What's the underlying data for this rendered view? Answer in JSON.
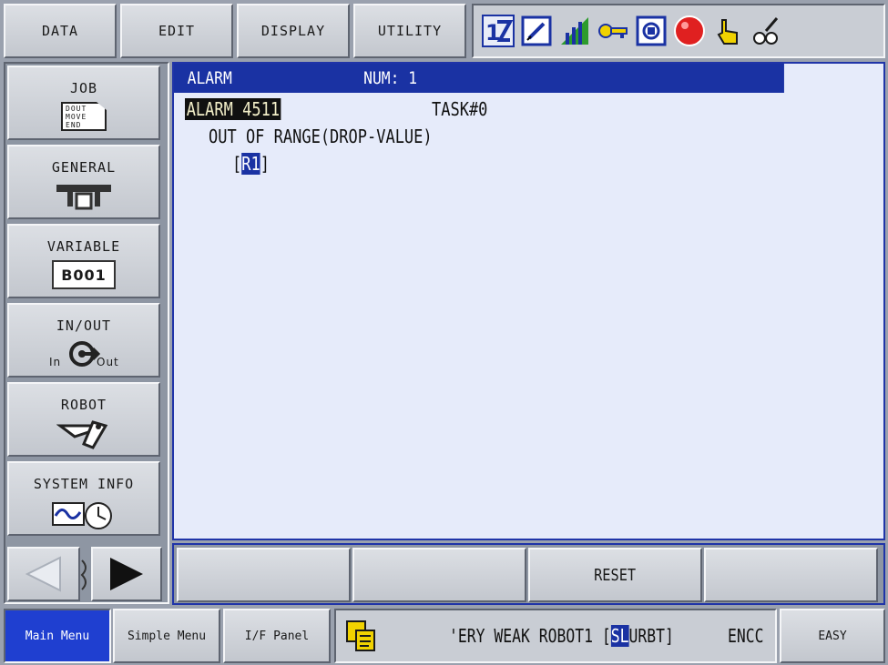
{
  "top_menu": {
    "items": [
      {
        "label": "DATA"
      },
      {
        "label": "EDIT"
      },
      {
        "label": "DISPLAY"
      },
      {
        "label": "UTILITY"
      }
    ]
  },
  "status_icons": [
    "robot-group-icon",
    "edit-mode-icon",
    "signal-strength-icon",
    "security-key-icon",
    "coordinate-frame-icon",
    "servo-stop-icon",
    "teach-hand-icon",
    "speed-icon"
  ],
  "side_menu": {
    "items": [
      {
        "label": "JOB",
        "icon": "job-icon",
        "icon_text": [
          "DOUT",
          "MOVE",
          "END"
        ]
      },
      {
        "label": "GENERAL",
        "icon": "general-tool-icon"
      },
      {
        "label": "VARIABLE",
        "icon": "variable-icon",
        "icon_text": "B001"
      },
      {
        "label": "IN/OUT",
        "icon": "inout-icon",
        "icon_in": "In",
        "icon_out": "Out"
      },
      {
        "label": "ROBOT",
        "icon": "robot-arm-icon"
      },
      {
        "label": "SYSTEM INFO",
        "icon": "system-info-icon"
      }
    ]
  },
  "alarm": {
    "title": "ALARM",
    "num_label": "NUM: 1",
    "code": "ALARM 4511",
    "task": "TASK#0",
    "message": "OUT OF RANGE(DROP-VALUE)",
    "target_open": "[",
    "target": "R1",
    "target_close": "]"
  },
  "function_keys": [
    {
      "label": ""
    },
    {
      "label": ""
    },
    {
      "label": "RESET"
    },
    {
      "label": ""
    }
  ],
  "bottom_bar": {
    "main_menu": "Main Menu",
    "simple_menu": "Simple Menu",
    "if_panel": "I/F Panel",
    "status_text_pre": "'ERY WEAK ROBOT1 [",
    "status_sel": "SL",
    "status_text_post": "URBT]",
    "status_right": "ENCC",
    "easy": "EASY"
  },
  "colors": {
    "title_blue": "#1a32a3",
    "main_menu_blue": "#1f3fd0",
    "alarm_highlight": "#101010",
    "stop_red": "#e02020"
  }
}
